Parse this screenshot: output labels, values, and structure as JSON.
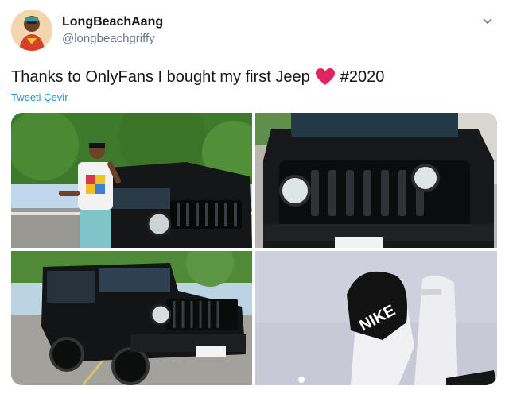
{
  "author": {
    "display_name": "LongBeachAang",
    "handle": "@longbeachgriffy"
  },
  "tweet": {
    "text_before": "Thanks to OnlyFans I bought my first Jeep",
    "hashtag": "#2020",
    "emoji": "heart-icon",
    "translate_label": "Tweeti Çevir"
  },
  "media": {
    "photos": [
      "man-with-jeep",
      "jeep-front-grille",
      "jeep-side-view",
      "feet-in-slides"
    ],
    "slide_text": "NIKE"
  },
  "colors": {
    "accent": "#1b95e0",
    "heart": "#e0245e",
    "text": "#14171a",
    "muted": "#657786"
  }
}
